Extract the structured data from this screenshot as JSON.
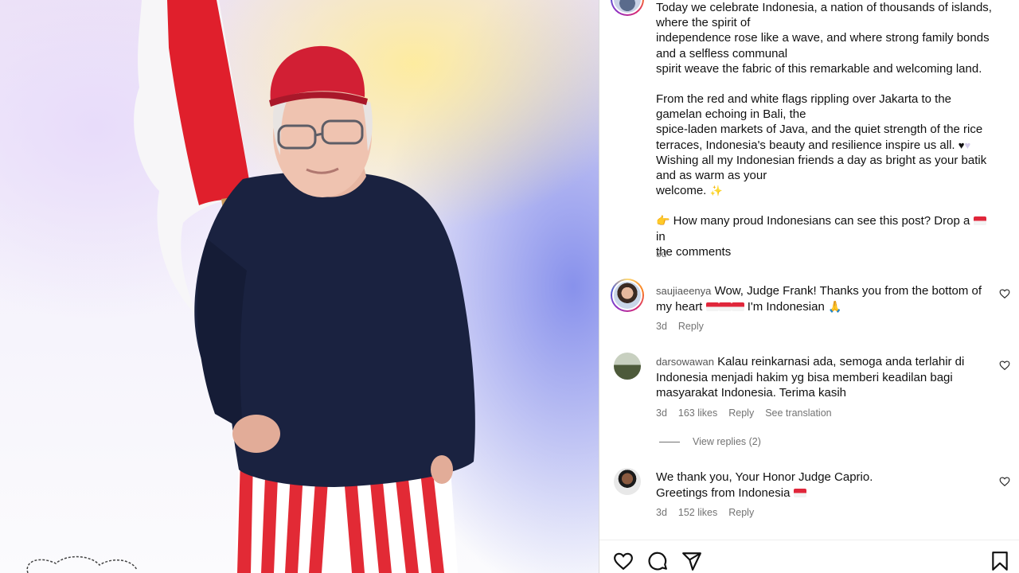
{
  "post": {
    "caption_paragraphs": [
      "Today we celebrate Indonesia, a nation of thousands of islands,\nwhere the spirit of\nindependence rose like a wave, and where strong family bonds\nand a selfless communal\nspirit weave the fabric of this remarkable and welcoming land.",
      "From the red and white flags rippling over Jakarta to the\ngamelan echoing in Bali, the\nspice-laden markets of Java, and the quiet strength of the rice\nterraces, Indonesia's beauty and resilience inspire us all.",
      "Wishing all my Indonesian friends a day as bright as your batik\nand as warm as your\nwelcome.",
      "How many proud Indonesians can see this post? Drop a",
      "in\nthe comments"
    ],
    "time": "3d"
  },
  "comments": [
    {
      "username": "saujiaeenya",
      "text_a": "Wow, Judge Frank! Thanks you from the bottom of\nmy heart",
      "text_b": " I'm Indonesian ",
      "time": "3d",
      "likes": "",
      "reply": "Reply",
      "translation": ""
    },
    {
      "username": "darsowawan",
      "text_a": "Kalau reinkarnasi ada, semoga anda terlahir di\nIndonesia menjadi hakim yg bisa memberi keadilan bagi\nmasyarakat Indonesia. Terima kasih",
      "text_b": "",
      "time": "3d",
      "likes": "163 likes",
      "reply": "Reply",
      "translation": "See translation"
    },
    {
      "username": "",
      "text_a": "We thank you, Your Honor Judge Caprio.\nGreetings from Indonesia",
      "text_b": "",
      "time": "3d",
      "likes": "152 likes",
      "reply": "Reply",
      "translation": ""
    }
  ],
  "view_replies": "View replies (2)",
  "icons": {
    "like": "heart-icon",
    "comment": "comment-icon",
    "share": "send-icon",
    "save": "bookmark-icon"
  },
  "colors": {
    "flag_red": "#e0263a",
    "muted_text": "#737373",
    "divider": "#dbdbdb"
  }
}
